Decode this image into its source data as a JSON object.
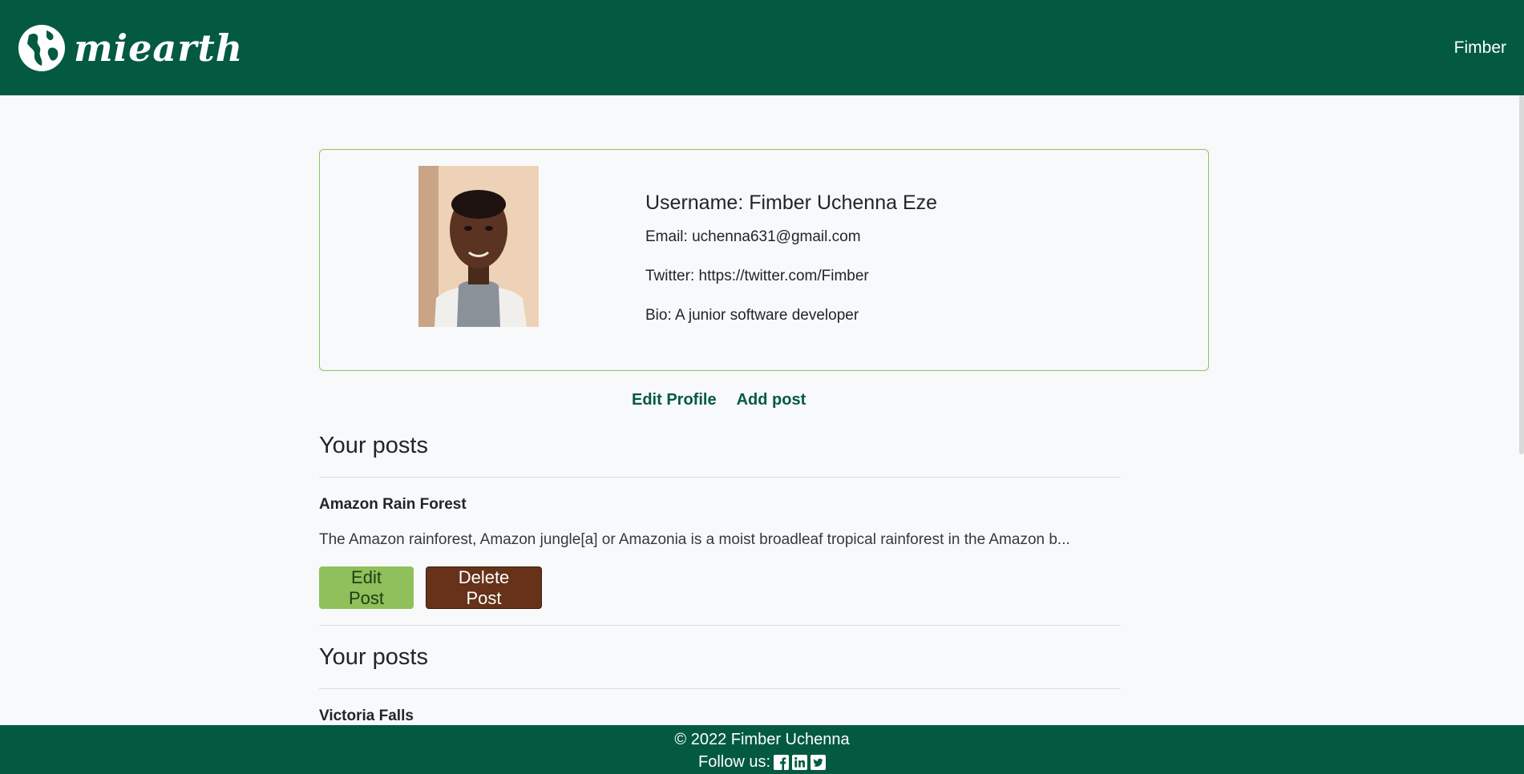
{
  "navbar": {
    "brand": "miearth",
    "user": "Fimber"
  },
  "profile": {
    "username_label": "Username: Fimber Uchenna Eze",
    "email": "Email: uchenna631@gmail.com",
    "twitter": "Twitter: https://twitter.com/Fimber",
    "bio": "Bio: A junior software developer"
  },
  "actions": {
    "edit_profile": "Edit Profile",
    "add_post": "Add post"
  },
  "posts": {
    "section_title": "Your posts",
    "items": [
      {
        "title": "Amazon Rain Forest",
        "excerpt": "The Amazon rainforest, Amazon jungle[a] or Amazonia is a moist broadleaf tropical rainforest in the Amazon b...",
        "edit_label": "Edit Post",
        "delete_label": "Delete Post"
      },
      {
        "title": "Victoria Falls"
      }
    ]
  },
  "footer": {
    "copyright": "© 2022 Fimber Uchenna",
    "follow": "Follow us:"
  },
  "colors": {
    "primary": "#035a40",
    "edit_btn": "#8fc05c",
    "delete_btn": "#66321a",
    "card_border": "#8fc16a"
  },
  "icons": [
    "globe-icon",
    "facebook-icon",
    "linkedin-icon",
    "twitter-icon"
  ]
}
